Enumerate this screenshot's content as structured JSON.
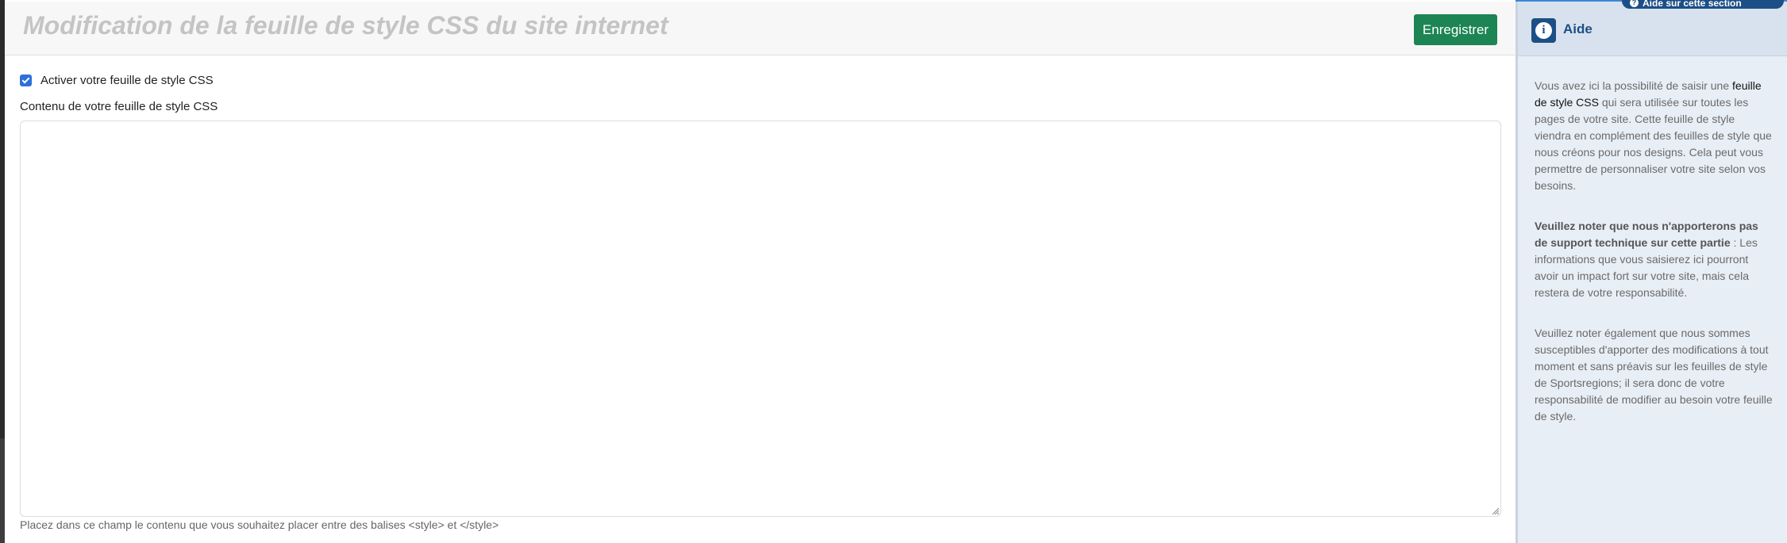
{
  "header": {
    "title": "Modification de la feuille de style CSS du site internet",
    "save_label": "Enregistrer"
  },
  "form": {
    "checkbox_label": "Activer votre feuille de style CSS",
    "checkbox_checked": true,
    "textarea_label": "Contenu de votre feuille de style CSS",
    "textarea_value": "",
    "hint": "Placez dans ce champ le contenu que vous souhaitez placer entre des balises <style> et </style>"
  },
  "sidebar": {
    "tab_label": "Aide sur cette section",
    "title": "Aide",
    "p1_pre": "Vous avez ici la possibilité de saisir une ",
    "p1_link": "feuille de style CSS",
    "p1_post": " qui sera utilisée sur toutes les pages de votre site. Cette feuille de style viendra en complément des feuilles de style que nous créons pour nos designs. Cela peut vous permettre de personnaliser votre site selon vos besoins.",
    "p2_bold": "Veuillez noter que nous n'apporterons pas de support technique sur cette partie",
    "p2_post": " : Les informations que vous saisierez ici pourront avoir un impact fort sur votre site, mais cela restera de votre responsabilité.",
    "p3": "Veuillez noter également que nous sommes susceptibles d'apporter des modifications à tout moment et sans préavis sur les feuilles de style de Sportsregions; il sera donc de votre responsabilité de modifier au besoin votre feuille de style."
  },
  "colors": {
    "accent": "#1c4f86",
    "save_button": "#1c8553",
    "checkbox": "#2f6fd8"
  }
}
